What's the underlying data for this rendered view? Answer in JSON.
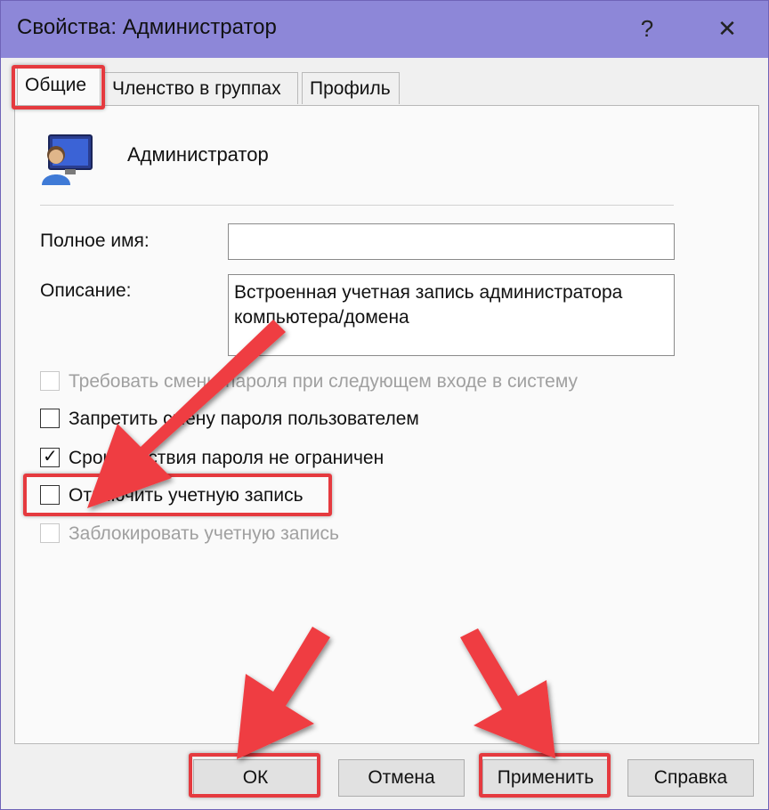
{
  "window": {
    "title": "Свойства: Администратор",
    "help_glyph": "?",
    "close_glyph": "✕"
  },
  "tabs": [
    {
      "label": "Общие"
    },
    {
      "label": "Членство в группах"
    },
    {
      "label": "Профиль"
    }
  ],
  "user": {
    "name": "Администратор",
    "icon": "user-monitor-icon"
  },
  "fields": {
    "full_name_label": "Полное имя:",
    "full_name_value": "",
    "description_label": "Описание:",
    "description_value": "Встроенная учетная запись администратора компьютера/домена"
  },
  "checkboxes": [
    {
      "label": "Требовать смены пароля при следующем входе в систему",
      "checked": false,
      "enabled": false
    },
    {
      "label": "Запретить смену пароля пользователем",
      "checked": false,
      "enabled": true
    },
    {
      "label": "Срок действия пароля не ограничен",
      "checked": true,
      "enabled": true
    },
    {
      "label": "Отключить учетную запись",
      "checked": false,
      "enabled": true
    },
    {
      "label": "Заблокировать учетную запись",
      "checked": false,
      "enabled": false
    }
  ],
  "check_glyph": "✓",
  "buttons": {
    "ok": "ОК",
    "cancel": "Отмена",
    "apply": "Применить",
    "help": "Справка"
  },
  "colors": {
    "titlebar": "#8d87d8",
    "highlight": "#e53a3f",
    "arrow": "#ef3e43"
  }
}
